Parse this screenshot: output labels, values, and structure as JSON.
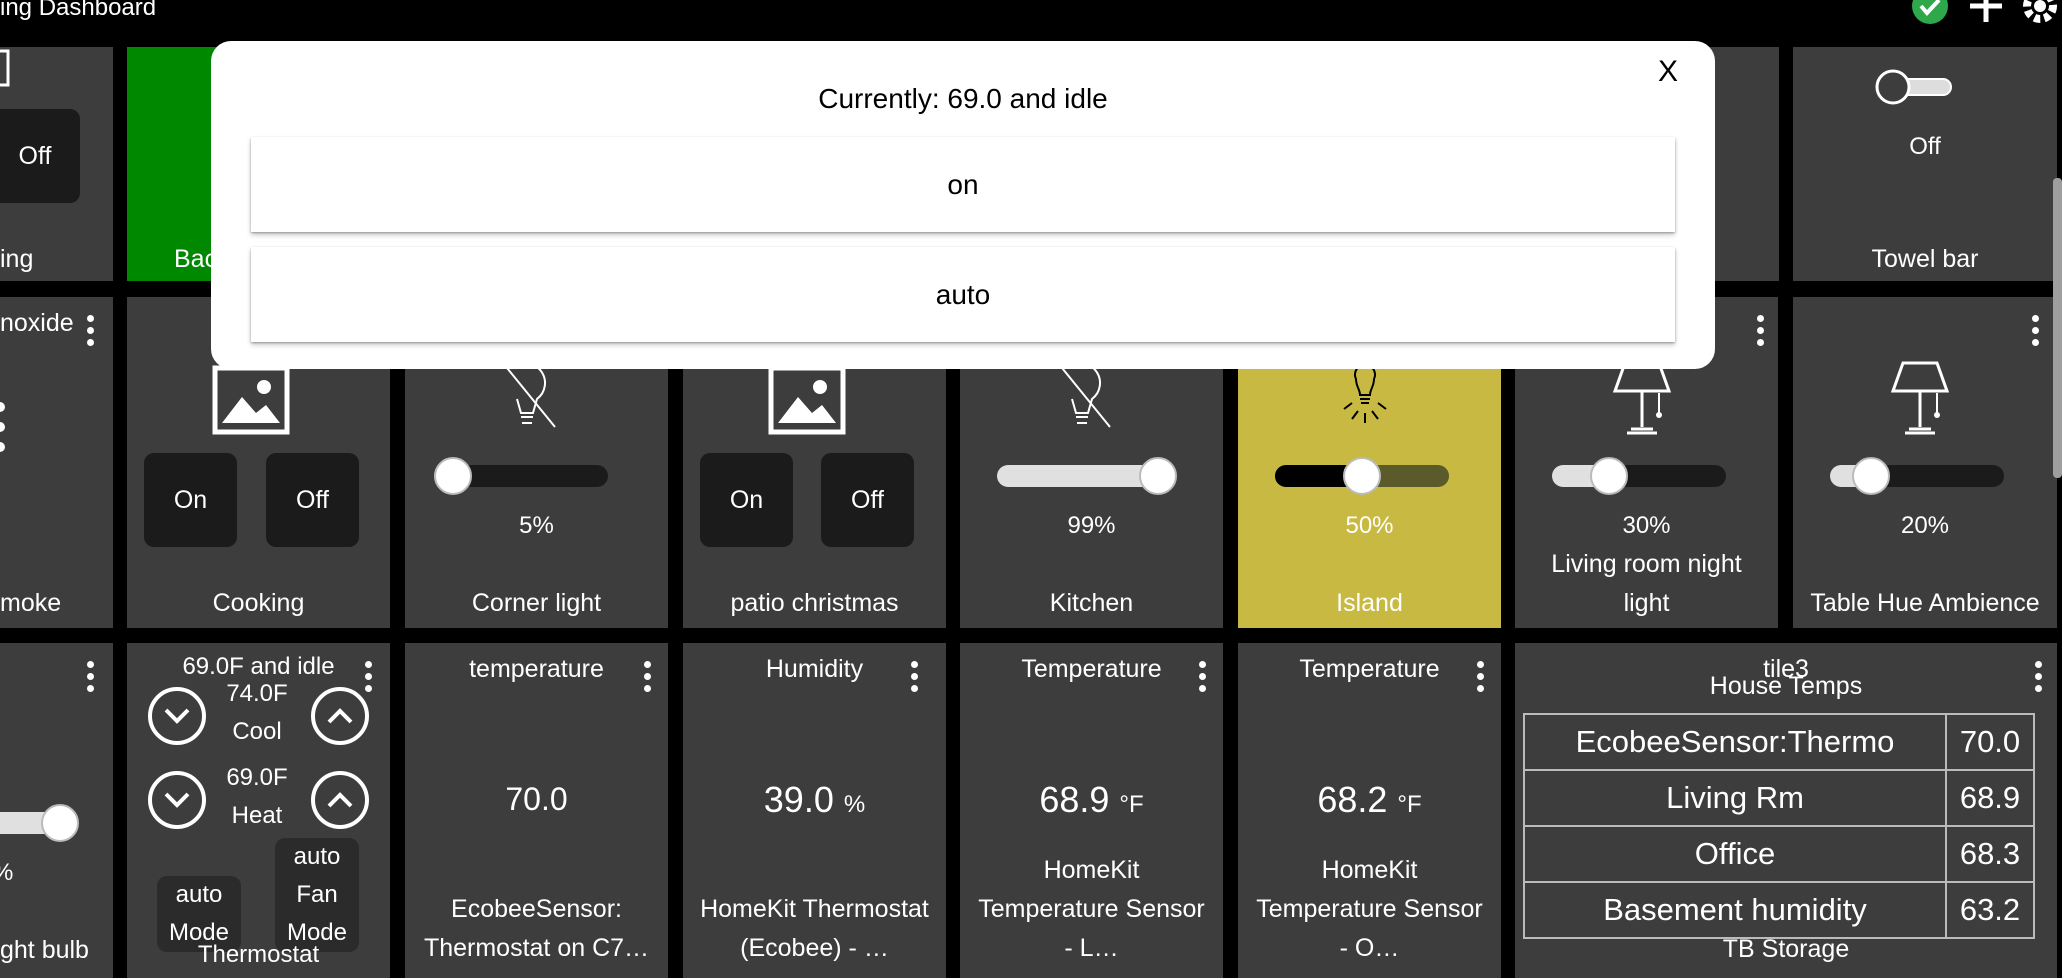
{
  "header": {
    "title": "ing Dashboard",
    "icons": [
      "check-circle-icon",
      "plus-icon",
      "gear-icon"
    ]
  },
  "colors": {
    "tile_bg": "#3d3d3d",
    "active_green": "#008800",
    "active_yellow": "#c8b942",
    "button_bg": "#1b1b1b"
  },
  "row1": {
    "t0": {
      "button": "Off",
      "label": "ing"
    },
    "t1": {
      "label": "Bac"
    },
    "towel": {
      "state": "Off",
      "label": "Towel bar"
    }
  },
  "row2": {
    "smoke": {
      "title": "noxide",
      "label": "moke"
    },
    "cooking": {
      "on": "On",
      "off": "Off",
      "label": "Cooking"
    },
    "corner": {
      "level": "5%",
      "label": "Corner light",
      "value": 5
    },
    "patio": {
      "on": "On",
      "off": "Off",
      "label": "patio christmas"
    },
    "kitchen": {
      "level": "99%",
      "label": "Kitchen",
      "value": 99
    },
    "island": {
      "level": "50%",
      "label": "Island",
      "value": 50
    },
    "livingnight": {
      "level": "30%",
      "label_line1": "Living room night",
      "label_line2": "light",
      "value": 30
    },
    "tablehue": {
      "level": "20%",
      "label": "Table Hue Ambience",
      "value": 20
    }
  },
  "row3": {
    "bulb": {
      "level": "%",
      "label": "ght bulb"
    },
    "thermostat": {
      "status": "69.0F and idle",
      "cool_set": "74.0F",
      "cool_label": "Cool",
      "heat_set": "69.0F",
      "heat_label": "Heat",
      "mode_line1": "auto",
      "mode_line2": "Mode",
      "fan_line1": "auto",
      "fan_line2": "Fan",
      "fan_line3": "Mode",
      "label": "Thermostat"
    },
    "ecobee_temp": {
      "title": "temperature",
      "value": "70.0",
      "sub1": "EcobeeSensor:",
      "sub2": "Thermostat on C7…"
    },
    "humidity": {
      "title": "Humidity",
      "value": "39.0",
      "unit": "%",
      "sub1": "HomeKit Thermostat",
      "sub2": "(Ecobee) - …"
    },
    "temp_l": {
      "title": "Temperature",
      "value": "68.9",
      "unit": "°F",
      "sub1": "HomeKit",
      "sub2": "Temperature Sensor",
      "sub3": "- L…"
    },
    "temp_o": {
      "title": "Temperature",
      "value": "68.2",
      "unit": "°F",
      "sub1": "HomeKit",
      "sub2": "Temperature Sensor",
      "sub3": "- O…"
    },
    "house": {
      "tile_name": "tile3",
      "title": "House Temps",
      "rows": [
        {
          "name": "EcobeeSensor:Thermo",
          "value": "70.0"
        },
        {
          "name": "Living Rm",
          "value": "68.9"
        },
        {
          "name": "Office",
          "value": "68.3"
        },
        {
          "name": "Basement humidity",
          "value": "63.2"
        }
      ],
      "footer": "TB Storage"
    }
  },
  "modal": {
    "title": "Currently: 69.0 and idle",
    "close": "X",
    "options": [
      "on",
      "auto"
    ]
  }
}
